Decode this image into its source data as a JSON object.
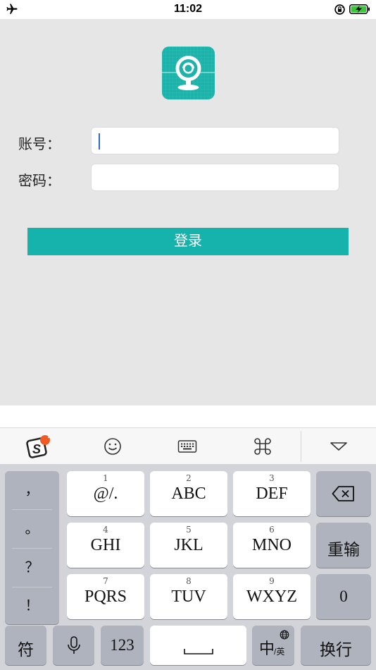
{
  "status_bar": {
    "time": "11:02",
    "icons": [
      "airplane-icon",
      "rotation-lock-icon",
      "battery-charging-icon"
    ]
  },
  "login": {
    "account_label": "账号：",
    "password_label": "密码：",
    "account_value": "",
    "password_value": "",
    "login_button": "登录"
  },
  "keyboard_toolbar": {
    "items": [
      "sogou-logo-icon",
      "emoji-icon",
      "keyboard-icon",
      "command-icon",
      "collapse-keyboard-icon"
    ],
    "badge": "!"
  },
  "keyboard": {
    "punctuation": [
      "，",
      "。",
      "？",
      "！"
    ],
    "keys": [
      {
        "num": "1",
        "label": "@/."
      },
      {
        "num": "2",
        "label": "ABC"
      },
      {
        "num": "3",
        "label": "DEF"
      },
      {
        "num": "4",
        "label": "GHI"
      },
      {
        "num": "5",
        "label": "JKL"
      },
      {
        "num": "6",
        "label": "MNO"
      },
      {
        "num": "7",
        "label": "PQRS"
      },
      {
        "num": "8",
        "label": "TUV"
      },
      {
        "num": "9",
        "label": "WXYZ"
      }
    ],
    "reenter": "重输",
    "zero": "0",
    "symbol": "符",
    "numbers": "123",
    "chinese": "中",
    "english": "/英",
    "return": "换行"
  },
  "colors": {
    "accent": "#16b3ad",
    "badge": "#f05a24",
    "caret": "#2f66e0"
  }
}
